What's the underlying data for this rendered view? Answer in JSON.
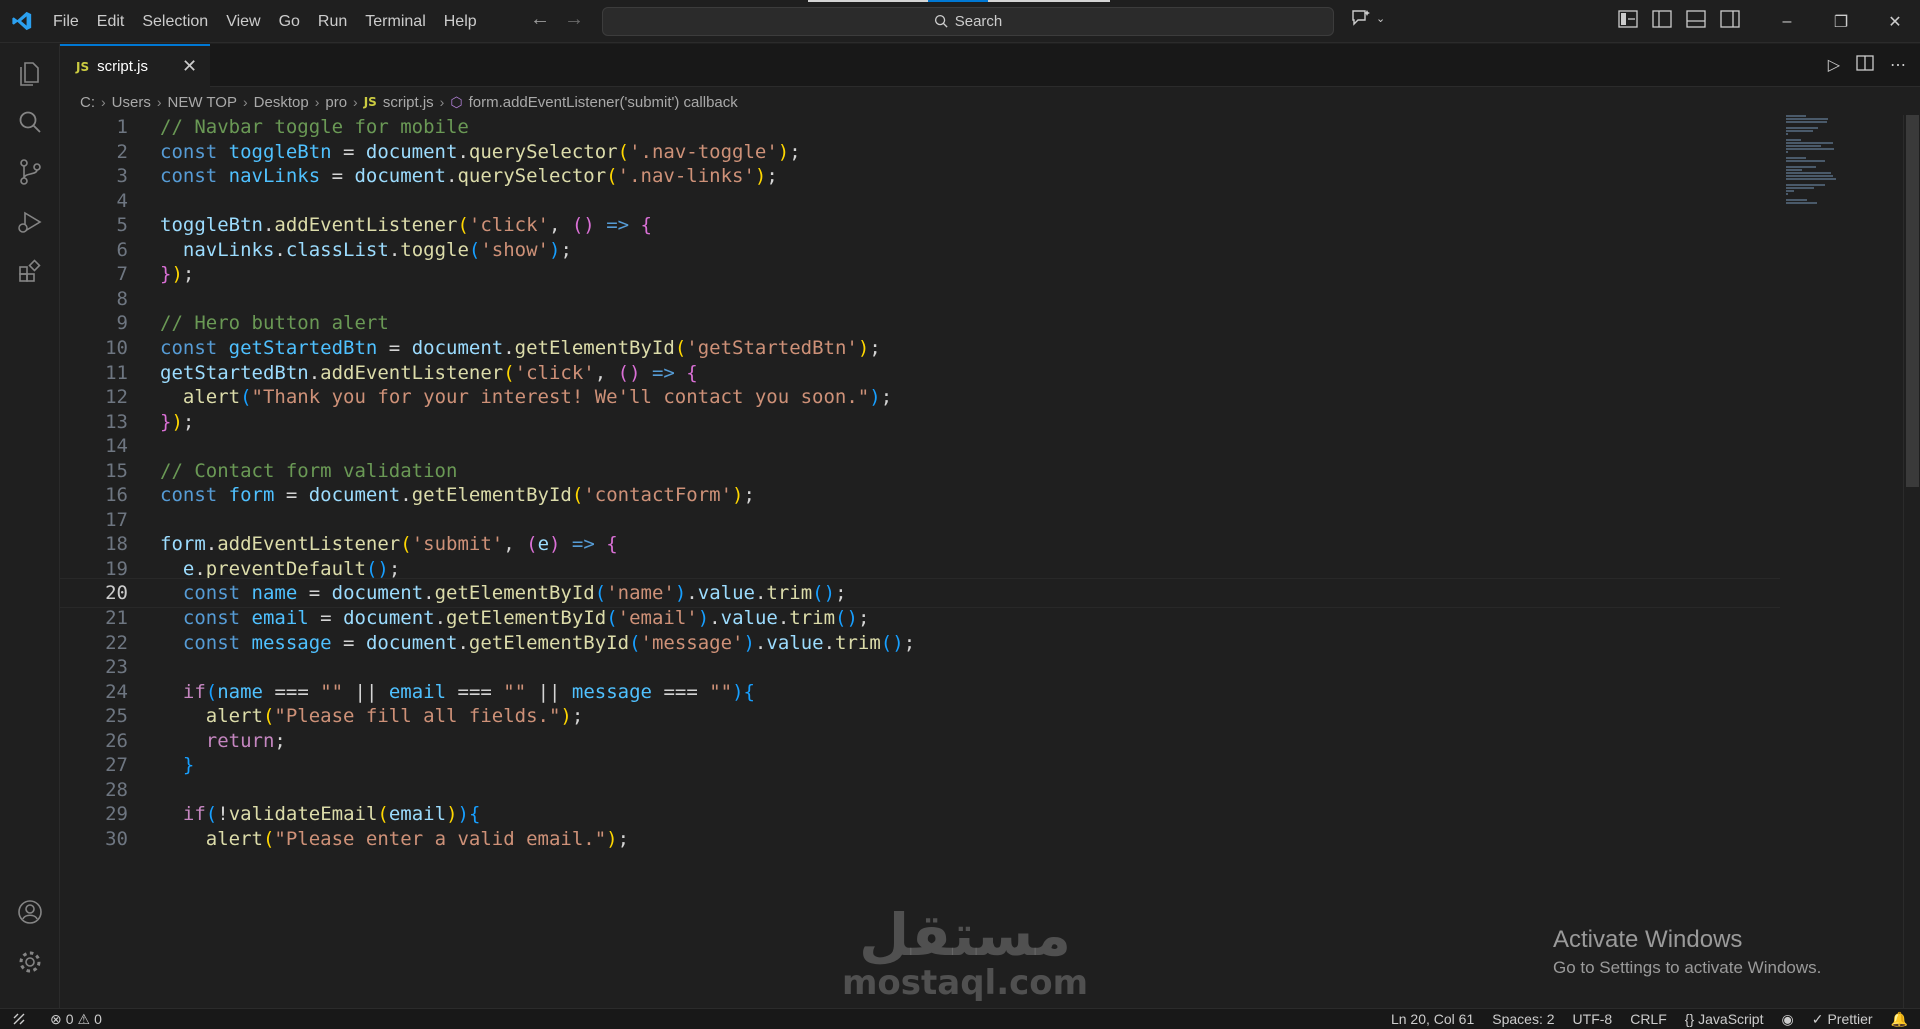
{
  "titlebar": {
    "menu": [
      "File",
      "Edit",
      "Selection",
      "View",
      "Go",
      "Run",
      "Terminal",
      "Help"
    ],
    "search_label": "Search"
  },
  "tab": {
    "label": "script.js",
    "badge": "JS"
  },
  "breadcrumb": [
    "C:",
    "Users",
    "NEW TOP",
    "Desktop",
    "pro",
    "script.js",
    "form.addEventListener('submit') callback"
  ],
  "editor": {
    "current_line": 20,
    "lines": [
      {
        "n": "1",
        "tokens": [
          [
            "c",
            "// Navbar toggle for mobile"
          ]
        ]
      },
      {
        "n": "2",
        "tokens": [
          [
            "k",
            "const "
          ],
          [
            "cv",
            "toggleBtn"
          ],
          [
            "p",
            " = "
          ],
          [
            "v",
            "document"
          ],
          [
            "p",
            "."
          ],
          [
            "f",
            "querySelector"
          ],
          [
            "b1",
            "("
          ],
          [
            "s",
            "'.nav-toggle'"
          ],
          [
            "b1",
            ")"
          ],
          [
            "p",
            ";"
          ]
        ]
      },
      {
        "n": "3",
        "tokens": [
          [
            "k",
            "const "
          ],
          [
            "cv",
            "navLinks"
          ],
          [
            "p",
            " = "
          ],
          [
            "v",
            "document"
          ],
          [
            "p",
            "."
          ],
          [
            "f",
            "querySelector"
          ],
          [
            "b1",
            "("
          ],
          [
            "s",
            "'.nav-links'"
          ],
          [
            "b1",
            ")"
          ],
          [
            "p",
            ";"
          ]
        ]
      },
      {
        "n": "4",
        "tokens": []
      },
      {
        "n": "5",
        "tokens": [
          [
            "v",
            "toggleBtn"
          ],
          [
            "p",
            "."
          ],
          [
            "f",
            "addEventListener"
          ],
          [
            "b1",
            "("
          ],
          [
            "s",
            "'click'"
          ],
          [
            "p",
            ", "
          ],
          [
            "b2",
            "()"
          ],
          [
            "k",
            " => "
          ],
          [
            "b2",
            "{"
          ]
        ]
      },
      {
        "n": "6",
        "tokens": [
          [
            "p",
            "  "
          ],
          [
            "v",
            "navLinks"
          ],
          [
            "p",
            "."
          ],
          [
            "v",
            "classList"
          ],
          [
            "p",
            "."
          ],
          [
            "f",
            "toggle"
          ],
          [
            "b3",
            "("
          ],
          [
            "s",
            "'show'"
          ],
          [
            "b3",
            ")"
          ],
          [
            "p",
            ";"
          ]
        ]
      },
      {
        "n": "7",
        "tokens": [
          [
            "b2",
            "}"
          ],
          [
            "b1",
            ")"
          ],
          [
            "p",
            ";"
          ]
        ]
      },
      {
        "n": "8",
        "tokens": []
      },
      {
        "n": "9",
        "tokens": [
          [
            "c",
            "// Hero button alert"
          ]
        ]
      },
      {
        "n": "10",
        "tokens": [
          [
            "k",
            "const "
          ],
          [
            "cv",
            "getStartedBtn"
          ],
          [
            "p",
            " = "
          ],
          [
            "v",
            "document"
          ],
          [
            "p",
            "."
          ],
          [
            "f",
            "getElementById"
          ],
          [
            "b1",
            "("
          ],
          [
            "s",
            "'getStartedBtn'"
          ],
          [
            "b1",
            ")"
          ],
          [
            "p",
            ";"
          ]
        ]
      },
      {
        "n": "11",
        "tokens": [
          [
            "v",
            "getStartedBtn"
          ],
          [
            "p",
            "."
          ],
          [
            "f",
            "addEventListener"
          ],
          [
            "b1",
            "("
          ],
          [
            "s",
            "'click'"
          ],
          [
            "p",
            ", "
          ],
          [
            "b2",
            "()"
          ],
          [
            "k",
            " => "
          ],
          [
            "b2",
            "{"
          ]
        ]
      },
      {
        "n": "12",
        "tokens": [
          [
            "p",
            "  "
          ],
          [
            "f",
            "alert"
          ],
          [
            "b3",
            "("
          ],
          [
            "s",
            "\"Thank you for your interest! We'll contact you soon.\""
          ],
          [
            "b3",
            ")"
          ],
          [
            "p",
            ";"
          ]
        ]
      },
      {
        "n": "13",
        "tokens": [
          [
            "b2",
            "}"
          ],
          [
            "b1",
            ")"
          ],
          [
            "p",
            ";"
          ]
        ]
      },
      {
        "n": "14",
        "tokens": []
      },
      {
        "n": "15",
        "tokens": [
          [
            "c",
            "// Contact form validation"
          ]
        ]
      },
      {
        "n": "16",
        "tokens": [
          [
            "k",
            "const "
          ],
          [
            "cv",
            "form"
          ],
          [
            "p",
            " = "
          ],
          [
            "v",
            "document"
          ],
          [
            "p",
            "."
          ],
          [
            "f",
            "getElementById"
          ],
          [
            "b1",
            "("
          ],
          [
            "s",
            "'contactForm'"
          ],
          [
            "b1",
            ")"
          ],
          [
            "p",
            ";"
          ]
        ]
      },
      {
        "n": "17",
        "tokens": []
      },
      {
        "n": "18",
        "tokens": [
          [
            "v",
            "form"
          ],
          [
            "p",
            "."
          ],
          [
            "f",
            "addEventListener"
          ],
          [
            "b1",
            "("
          ],
          [
            "s",
            "'submit'"
          ],
          [
            "p",
            ", "
          ],
          [
            "b2",
            "("
          ],
          [
            "v",
            "e"
          ],
          [
            "b2",
            ")"
          ],
          [
            "k",
            " => "
          ],
          [
            "b2",
            "{"
          ]
        ]
      },
      {
        "n": "19",
        "tokens": [
          [
            "p",
            "  "
          ],
          [
            "v",
            "e"
          ],
          [
            "p",
            "."
          ],
          [
            "f",
            "preventDefault"
          ],
          [
            "b3",
            "()"
          ],
          [
            "p",
            ";"
          ]
        ]
      },
      {
        "n": "20",
        "tokens": [
          [
            "p",
            "  "
          ],
          [
            "k",
            "const "
          ],
          [
            "cv",
            "name"
          ],
          [
            "p",
            " = "
          ],
          [
            "v",
            "document"
          ],
          [
            "p",
            "."
          ],
          [
            "f",
            "getElementById"
          ],
          [
            "b3",
            "("
          ],
          [
            "s",
            "'name'"
          ],
          [
            "b3",
            ")"
          ],
          [
            "p",
            "."
          ],
          [
            "v",
            "value"
          ],
          [
            "p",
            "."
          ],
          [
            "f",
            "trim"
          ],
          [
            "b3",
            "()"
          ],
          [
            "p",
            ";"
          ]
        ]
      },
      {
        "n": "21",
        "tokens": [
          [
            "p",
            "  "
          ],
          [
            "k",
            "const "
          ],
          [
            "cv",
            "email"
          ],
          [
            "p",
            " = "
          ],
          [
            "v",
            "document"
          ],
          [
            "p",
            "."
          ],
          [
            "f",
            "getElementById"
          ],
          [
            "b3",
            "("
          ],
          [
            "s",
            "'email'"
          ],
          [
            "b3",
            ")"
          ],
          [
            "p",
            "."
          ],
          [
            "v",
            "value"
          ],
          [
            "p",
            "."
          ],
          [
            "f",
            "trim"
          ],
          [
            "b3",
            "()"
          ],
          [
            "p",
            ";"
          ]
        ]
      },
      {
        "n": "22",
        "tokens": [
          [
            "p",
            "  "
          ],
          [
            "k",
            "const "
          ],
          [
            "cv",
            "message"
          ],
          [
            "p",
            " = "
          ],
          [
            "v",
            "document"
          ],
          [
            "p",
            "."
          ],
          [
            "f",
            "getElementById"
          ],
          [
            "b3",
            "("
          ],
          [
            "s",
            "'message'"
          ],
          [
            "b3",
            ")"
          ],
          [
            "p",
            "."
          ],
          [
            "v",
            "value"
          ],
          [
            "p",
            "."
          ],
          [
            "f",
            "trim"
          ],
          [
            "b3",
            "()"
          ],
          [
            "p",
            ";"
          ]
        ]
      },
      {
        "n": "23",
        "tokens": []
      },
      {
        "n": "24",
        "tokens": [
          [
            "p",
            "  "
          ],
          [
            "kc",
            "if"
          ],
          [
            "b3",
            "("
          ],
          [
            "cv",
            "name"
          ],
          [
            "p",
            " === "
          ],
          [
            "s",
            "\"\""
          ],
          [
            "p",
            " || "
          ],
          [
            "cv",
            "email"
          ],
          [
            "p",
            " === "
          ],
          [
            "s",
            "\"\""
          ],
          [
            "p",
            " || "
          ],
          [
            "cv",
            "message"
          ],
          [
            "p",
            " === "
          ],
          [
            "s",
            "\"\""
          ],
          [
            "b3",
            ")"
          ],
          [
            "b3",
            "{"
          ]
        ]
      },
      {
        "n": "25",
        "tokens": [
          [
            "p",
            "    "
          ],
          [
            "f",
            "alert"
          ],
          [
            "b1",
            "("
          ],
          [
            "s",
            "\"Please fill all fields.\""
          ],
          [
            "b1",
            ")"
          ],
          [
            "p",
            ";"
          ]
        ]
      },
      {
        "n": "26",
        "tokens": [
          [
            "p",
            "    "
          ],
          [
            "kc",
            "return"
          ],
          [
            "p",
            ";"
          ]
        ]
      },
      {
        "n": "27",
        "tokens": [
          [
            "p",
            "  "
          ],
          [
            "b3",
            "}"
          ]
        ]
      },
      {
        "n": "28",
        "tokens": []
      },
      {
        "n": "29",
        "tokens": [
          [
            "p",
            "  "
          ],
          [
            "kc",
            "if"
          ],
          [
            "b3",
            "("
          ],
          [
            "p",
            "!"
          ],
          [
            "f",
            "validateEmail"
          ],
          [
            "b1",
            "("
          ],
          [
            "v",
            "email"
          ],
          [
            "b1",
            ")"
          ],
          [
            "b3",
            ")"
          ],
          [
            "b3",
            "{"
          ]
        ]
      },
      {
        "n": "30",
        "tokens": [
          [
            "p",
            "    "
          ],
          [
            "f",
            "alert"
          ],
          [
            "b1",
            "("
          ],
          [
            "s",
            "\"Please enter a valid email.\""
          ],
          [
            "b1",
            ")"
          ],
          [
            "p",
            ";"
          ]
        ]
      }
    ]
  },
  "watermark": {
    "arabic": "مستقل",
    "latin": "mostaql.com"
  },
  "activation": {
    "title": "Activate Windows",
    "subtitle": "Go to Settings to activate Windows."
  },
  "statusbar": {
    "errors": "0",
    "warnings": "0",
    "position": "Ln 20, Col 61",
    "spaces": "Spaces: 2",
    "encoding": "UTF-8",
    "eol": "CRLF",
    "language": "JavaScript",
    "formatter": "Prettier"
  },
  "colors": {
    "accent": "#0078d4",
    "background": "#1f1f1f",
    "js_badge": "#cbcb41"
  }
}
